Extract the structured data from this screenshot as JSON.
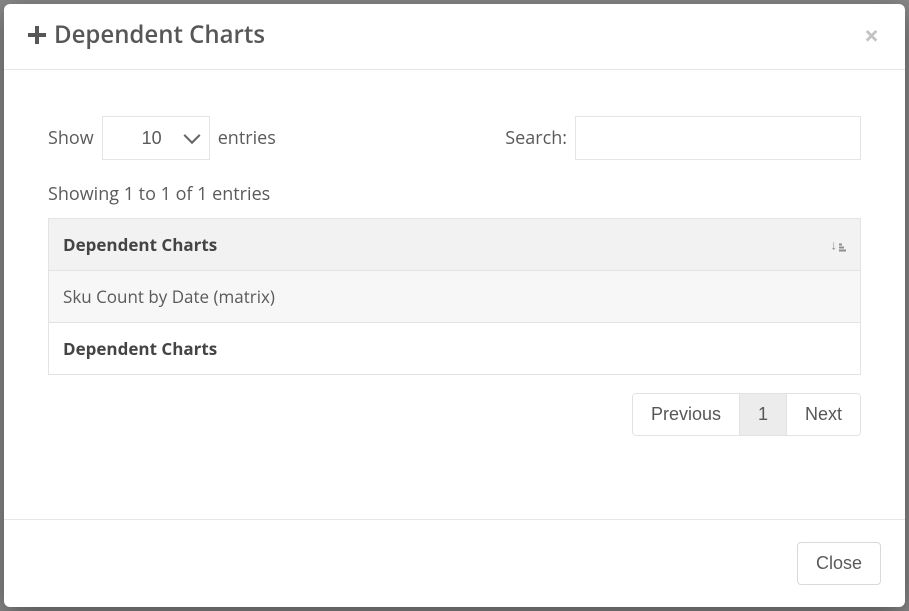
{
  "header": {
    "title": "Dependent Charts"
  },
  "lengthControl": {
    "prefix": "Show",
    "selected": "10",
    "suffix": "entries"
  },
  "search": {
    "label": "Search:",
    "value": ""
  },
  "info": "Showing 1 to 1 of 1 entries",
  "table": {
    "header": "Dependent Charts",
    "rows": [
      {
        "cell": "Sku Count by Date (matrix)"
      }
    ],
    "footer": "Dependent Charts"
  },
  "pagination": {
    "previous": "Previous",
    "pages": [
      "1"
    ],
    "next": "Next",
    "activeIndex": 0
  },
  "footer": {
    "close": "Close"
  }
}
